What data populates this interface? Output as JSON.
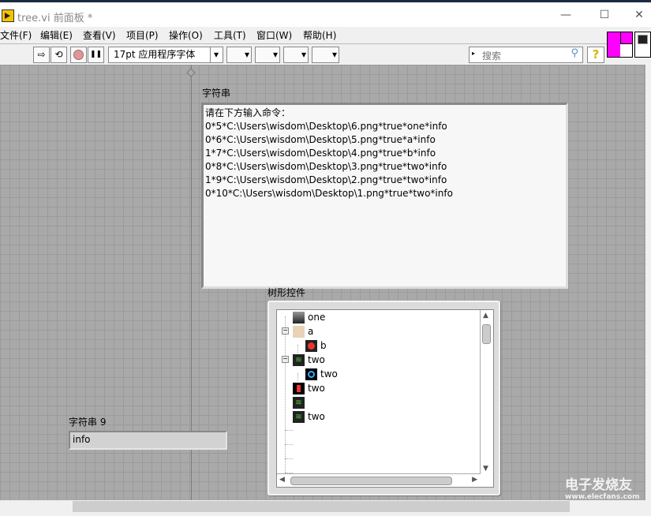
{
  "window": {
    "title": "tree.vi 前面板 *",
    "minimize": "—",
    "maximize": "☐",
    "close": "✕"
  },
  "menu": [
    "文件(F)",
    "编辑(E)",
    "查看(V)",
    "项目(P)",
    "操作(O)",
    "工具(T)",
    "窗口(W)",
    "帮助(H)"
  ],
  "toolbar": {
    "run": "⇨",
    "run_continuous": "⟲",
    "pause": "❚❚",
    "font": "17pt 应用程序字体",
    "font_arrow": "▾",
    "align": "▾",
    "distribute": "▾",
    "resize": "▾",
    "reorder": "▾",
    "search_placeholder": "搜索",
    "help": "?"
  },
  "string_control": {
    "label": "字符串",
    "lines": [
      "请在下方输入命令：",
      "0*5*C:\\Users\\wisdom\\Desktop\\6.png*true*one*info",
      "0*6*C:\\Users\\wisdom\\Desktop\\5.png*true*a*info",
      "1*7*C:\\Users\\wisdom\\Desktop\\4.png*true*b*info",
      "0*8*C:\\Users\\wisdom\\Desktop\\3.png*true*two*info",
      "1*9*C:\\Users\\wisdom\\Desktop\\2.png*true*two*info",
      "0*10*C:\\Users\\wisdom\\Desktop\\1.png*true*two*info"
    ]
  },
  "tree_control": {
    "label": "树形控件",
    "items": [
      {
        "text": "one",
        "level": 0,
        "icon": "image-thumbnail-icon",
        "expander": false
      },
      {
        "text": "a",
        "level": 0,
        "icon": "avatar-icon",
        "expander": true
      },
      {
        "text": "b",
        "level": 1,
        "icon": "notification-badge-icon",
        "expander": false
      },
      {
        "text": "two",
        "level": 0,
        "icon": "wifi-icon",
        "expander": true
      },
      {
        "text": "two",
        "level": 1,
        "icon": "cloud-icon",
        "expander": false
      },
      {
        "text": "two",
        "level": 0,
        "icon": "pin-icon",
        "expander": false
      },
      {
        "text": "",
        "level": 0,
        "icon": "wifi-icon",
        "expander": false
      },
      {
        "text": "two",
        "level": 0,
        "icon": "wifi-icon",
        "expander": false
      }
    ]
  },
  "string9": {
    "label": "字符串 9",
    "value": "info"
  },
  "watermark": {
    "brand": "电子发烧友",
    "url": "www.elecfans.com"
  }
}
